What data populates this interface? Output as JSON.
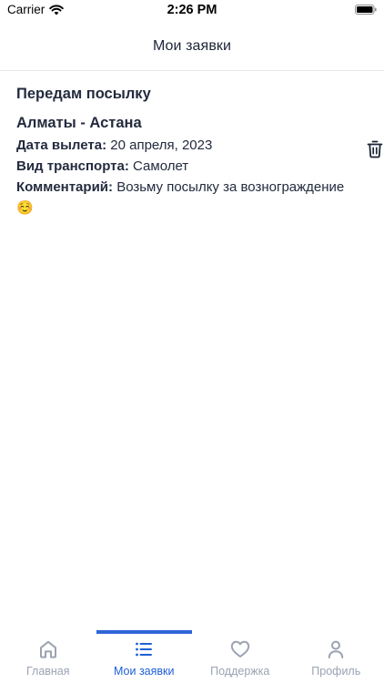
{
  "status_bar": {
    "carrier": "Carrier",
    "time": "2:26 PM"
  },
  "header": {
    "title": "Мои заявки"
  },
  "request": {
    "title": "Передам посылку",
    "route": "Алматы - Астана",
    "departure_label": "Дата вылета:",
    "departure_value": " 20 апреля, 2023",
    "transport_label": "Вид транспорта:",
    "transport_value": "Самолет",
    "comment_label": "Комментарий:",
    "comment_value": "Возьму посылку за вознограждение",
    "comment_emoji": "☺️"
  },
  "tabs": [
    {
      "label": "Главная",
      "icon": "home-icon",
      "active": false
    },
    {
      "label": "Мои заявки",
      "icon": "list-icon",
      "active": true
    },
    {
      "label": "Поддержка",
      "icon": "heart-icon",
      "active": false
    },
    {
      "label": "Профиль",
      "icon": "person-icon",
      "active": false
    }
  ],
  "colors": {
    "accent": "#1f5fd6",
    "inactive": "#9aa3b2",
    "text": "#232b3e"
  }
}
